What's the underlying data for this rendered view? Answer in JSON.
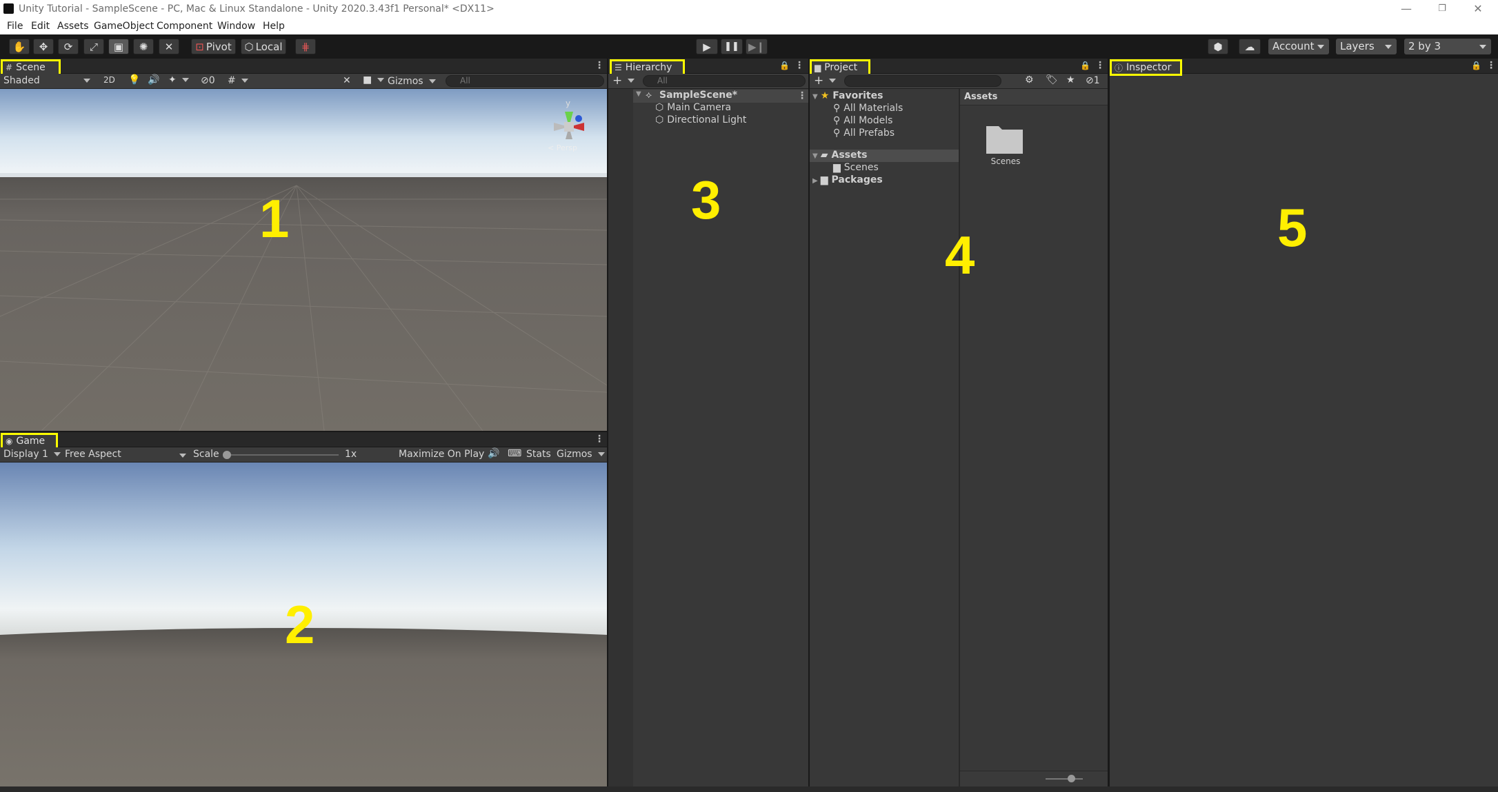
{
  "window": {
    "title": "Unity Tutorial - SampleScene - PC, Mac & Linux Standalone - Unity 2020.3.43f1 Personal* <DX11>",
    "controls": {
      "minimize": "—",
      "restore": "❐",
      "close": "✕"
    }
  },
  "menu": [
    "File",
    "Edit",
    "Assets",
    "GameObject",
    "Component",
    "Window",
    "Help"
  ],
  "toolbar": {
    "pivot": "Pivot",
    "local": "Local",
    "account": "Account",
    "layers": "Layers",
    "layout": "2 by 3"
  },
  "scene": {
    "tab": "Scene",
    "draw_mode": "Shaded",
    "mode_2d": "2D",
    "hidden_count": "0",
    "gizmos": "Gizmos",
    "search_placeholder": "All",
    "axis_y": "y",
    "persp": "< Persp",
    "number": "1"
  },
  "game": {
    "tab": "Game",
    "display": "Display 1",
    "aspect": "Free Aspect",
    "scale_label": "Scale",
    "scale_value": "1x",
    "maximize": "Maximize On Play",
    "stats": "Stats",
    "gizmos": "Gizmos",
    "number": "2"
  },
  "hierarchy": {
    "tab": "Hierarchy",
    "search_placeholder": "All",
    "scene_name": "SampleScene*",
    "items": [
      "Main Camera",
      "Directional Light"
    ],
    "number": "3"
  },
  "project": {
    "tab": "Project",
    "favorites": "Favorites",
    "favorite_items": [
      "All Materials",
      "All Models",
      "All Prefabs"
    ],
    "assets": "Assets",
    "asset_children": [
      "Scenes"
    ],
    "packages": "Packages",
    "hidden_count": "1",
    "grid_header": "Assets",
    "grid_items": [
      "Scenes"
    ],
    "number": "4"
  },
  "inspector": {
    "tab": "Inspector",
    "number": "5"
  },
  "colors": {
    "highlight": "#ffff00",
    "panel_bg": "#383838",
    "dark_bg": "#191919"
  }
}
